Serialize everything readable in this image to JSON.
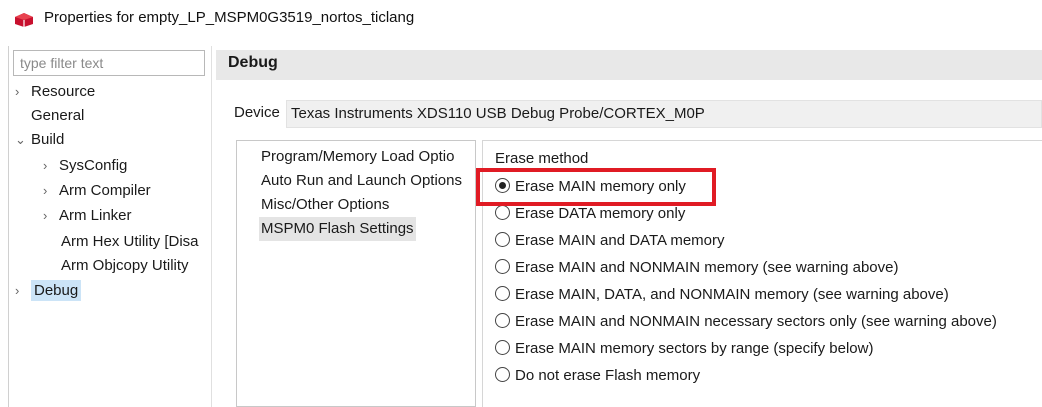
{
  "window": {
    "title": "Properties for empty_LP_MSPM0G3519_nortos_ticlang",
    "icon": "project-properties-icon"
  },
  "filter": {
    "placeholder": "type filter text"
  },
  "tree": {
    "items": [
      {
        "label": "Resource",
        "expander": "›"
      },
      {
        "label": "General"
      },
      {
        "label": "Build",
        "expander": "⌄"
      },
      {
        "label": "SysConfig",
        "expander": "›"
      },
      {
        "label": "Arm Compiler",
        "expander": "›"
      },
      {
        "label": "Arm Linker",
        "expander": "›"
      },
      {
        "label": "Arm Hex Utility  [Disa"
      },
      {
        "label": "Arm Objcopy Utility"
      },
      {
        "label": "Debug",
        "expander": "›"
      }
    ]
  },
  "header": {
    "title": "Debug"
  },
  "device": {
    "label": "Device",
    "value": "Texas Instruments XDS110 USB Debug Probe/CORTEX_M0P"
  },
  "options": {
    "items": [
      "Program/Memory Load Optio",
      "Auto Run and Launch Options",
      "Misc/Other Options",
      "MSPM0 Flash Settings"
    ]
  },
  "erase": {
    "label": "Erase method",
    "options": [
      "Erase MAIN memory only",
      "Erase DATA memory only",
      "Erase MAIN and DATA memory",
      "Erase MAIN and NONMAIN memory (see warning above)",
      "Erase MAIN, DATA, and NONMAIN memory (see warning above)",
      "Erase MAIN and NONMAIN necessary sectors only (see warning above)",
      "Erase MAIN memory sectors by range (specify below)",
      "Do not erase Flash memory"
    ],
    "selected": "Erase MAIN memory only"
  },
  "colors": {
    "highlight": "#e01b24",
    "selection": "#cce4f7"
  }
}
